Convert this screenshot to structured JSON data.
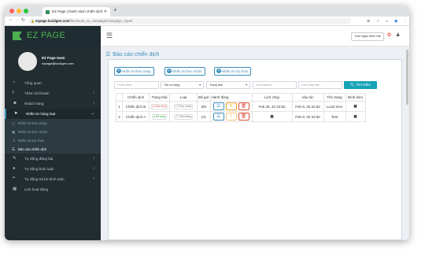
{
  "browser": {
    "tab_title": "EZ Page | Danh sách chiến dịch",
    "url_domain": "ezpage.lucidgen.com",
    "url_path": "/facebook_ex_campaign/campaign_report"
  },
  "sidebar": {
    "brand": "EZ PAGE",
    "user_name": "EZ Page team",
    "user_email": "ezpage@lucidgen.com",
    "items": [
      {
        "label": "Tổng quan",
        "icon": "dashboard-icon"
      },
      {
        "label": "Thêm tài khoản",
        "icon": "facebook-icon"
      },
      {
        "label": "Khách hàng",
        "icon": "users-icon"
      },
      {
        "label": "Nhắn tin hàng loạt",
        "icon": "paper-plane-icon"
      }
    ],
    "subitems": [
      {
        "label": "Nhắn tin theo trang",
        "icon": "file-icon"
      },
      {
        "label": "Nhắn tin theo nhóm",
        "icon": "group-icon"
      },
      {
        "label": "Nhắn tin tùy chọn",
        "icon": "shuffle-icon"
      },
      {
        "label": "Báo cáo chiến dịch",
        "icon": "list-icon"
      }
    ],
    "items2": [
      {
        "label": "Tự động đăng bài",
        "icon": "edit-icon"
      },
      {
        "label": "Tự động bình luận",
        "icon": "comment-icon"
      },
      {
        "label": "Tự động trả lời bình luận",
        "icon": "comments-icon"
      },
      {
        "label": "Lịch hoạt động",
        "icon": "calendar-icon"
      }
    ]
  },
  "topbar": {
    "user_button": "Trần Ngọc Minh Hải"
  },
  "page": {
    "title": "Báo cáo chiến dịch",
    "buttons": [
      "Nhắn tin theo trang",
      "Nhắn tin theo nhóm",
      "Nhắn tin tùy chọn"
    ],
    "filters": {
      "campaign_placeholder": "Chiến dịch",
      "type_select": "Tất cả trang",
      "status_select": "Trạng thái",
      "schedule_from": "Lịch chạy từ",
      "schedule_to": "Lịch chạy đến",
      "search_button": "Tìm kiếm"
    },
    "table": {
      "headers": [
        "",
        "Chiến dịch",
        "Trạng thái",
        "Loại",
        "Đã gửi",
        "Hành động",
        "Lịch chạy",
        "Vào lúc",
        "Tên trang",
        "Đính kèm"
      ],
      "rows": [
        {
          "no": "1",
          "campaign": "Chiến dịch B",
          "status": "Chờ xử lý",
          "type": "Theo nhóm",
          "sent": "0/5",
          "schedule": "Feb 29, 20 22:52",
          "at": "Feb 9, 20 22:52",
          "page": "Lucid Gen",
          "attach": "✖"
        },
        {
          "no": "2",
          "campaign": "Chiến dịch A",
          "status": "Đã xong",
          "type": "Theo trang",
          "sent": "1/1",
          "schedule": "✖",
          "at": "Feb 9, 20 22:50",
          "page": "Test",
          "attach": "✖"
        }
      ]
    }
  }
}
